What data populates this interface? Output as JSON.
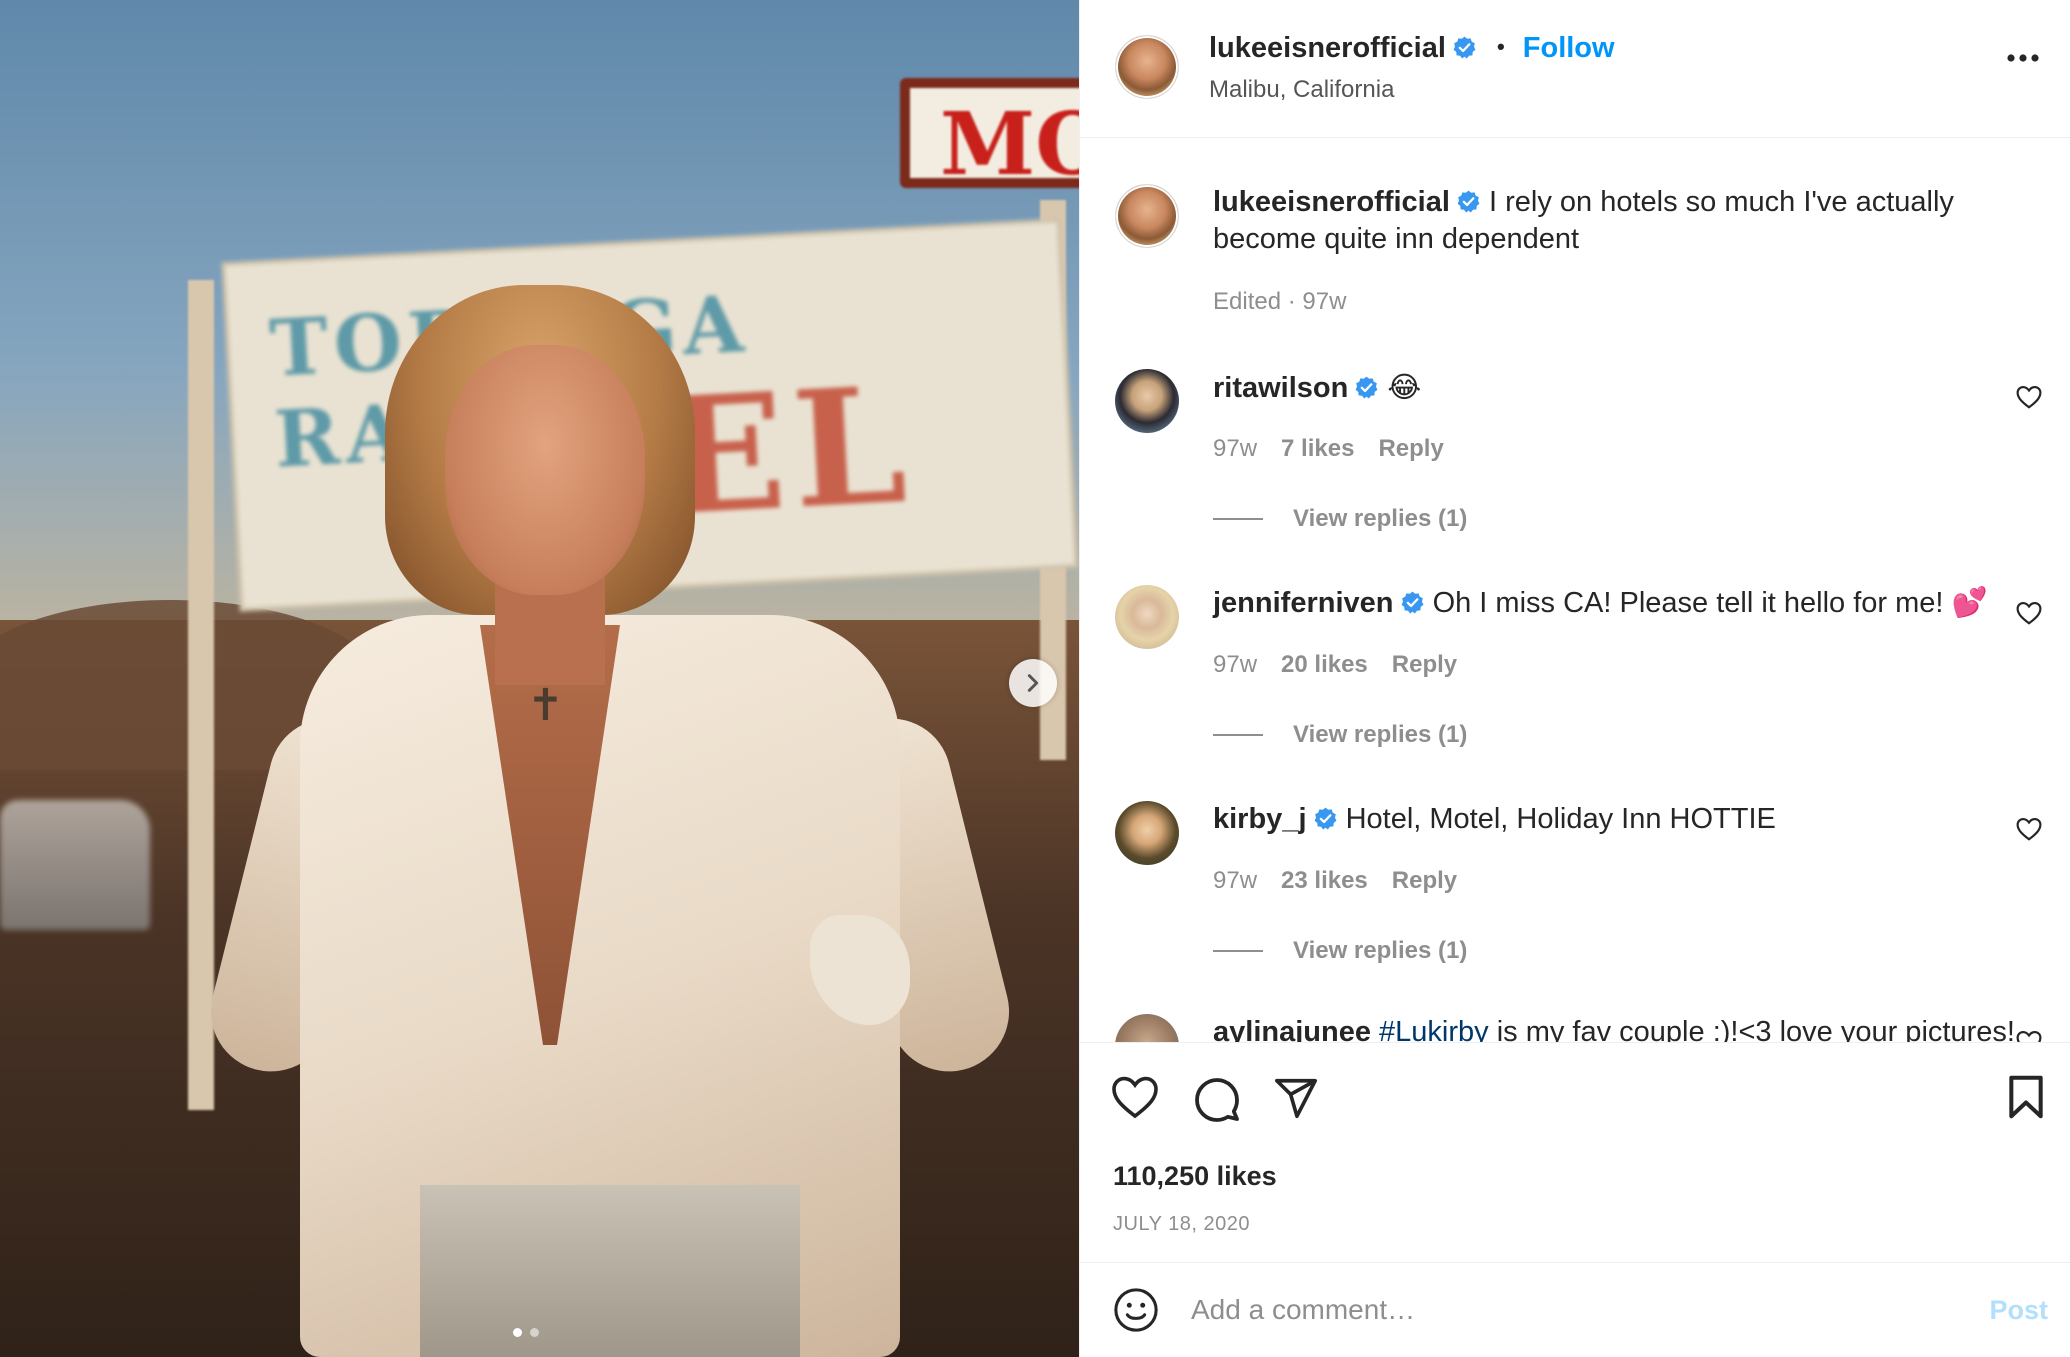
{
  "post": {
    "username": "lukeeisnerofficial",
    "verified": true,
    "follow_label": "Follow",
    "bullet": "•",
    "location": "Malibu, California",
    "caption": "I rely on hotels so much I've actually become quite inn dependent",
    "caption_meta": "Edited · 97w",
    "likes_text": "110,250 likes",
    "date": "JULY 18, 2020",
    "carousel": {
      "current": 1,
      "total": 2
    }
  },
  "photo_signs": {
    "motel_small": "MOT",
    "ranch_line": "TOPANGA RANCH",
    "motel_big": "TEL"
  },
  "comments": [
    {
      "username": "ritawilson",
      "verified": true,
      "text": "😂",
      "age": "97w",
      "likes": "7 likes",
      "reply_label": "Reply",
      "view_replies": "View replies (1)"
    },
    {
      "username": "jenniferniven",
      "verified": true,
      "text": "Oh I miss CA! Please tell it hello for me! 💕",
      "age": "97w",
      "likes": "20 likes",
      "reply_label": "Reply",
      "view_replies": "View replies (1)"
    },
    {
      "username": "kirby_j",
      "verified": true,
      "text": "Hotel, Motel, Holiday Inn HOTTIE",
      "age": "97w",
      "likes": "23 likes",
      "reply_label": "Reply",
      "view_replies": "View replies (1)"
    },
    {
      "username": "aylinajunee",
      "verified": false,
      "hashtag": "#Lukirby",
      "text": "is my fav couple :)!<3 love your pictures!"
    }
  ],
  "add_comment": {
    "placeholder": "Add a comment…",
    "post_label": "Post"
  },
  "colors": {
    "accent": "#0095f6",
    "verified": "#3897f0",
    "muted": "#8e8e8e",
    "post_disabled": "#b2dffc",
    "hashtag": "#00376b"
  }
}
